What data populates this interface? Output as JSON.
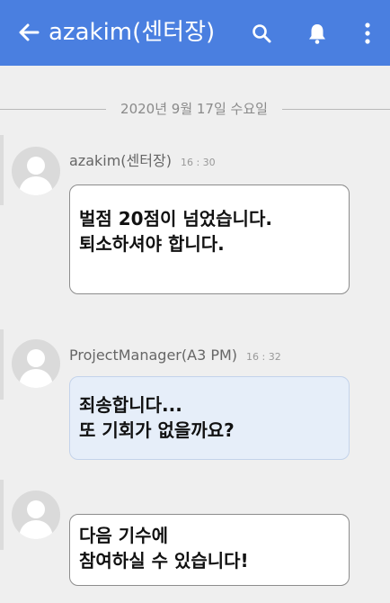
{
  "header": {
    "title": "azakim(센터장)",
    "bg_color": "#4a7fe0",
    "icons": [
      "back-arrow-icon",
      "search-icon",
      "bell-icon",
      "more-vertical-icon"
    ]
  },
  "date_divider": "2020년 9월 17일 수요일",
  "messages": [
    {
      "sender": "azakim(센터장)",
      "time": "16 : 30",
      "lines": [
        "벌점 20점이 넘었습니다.",
        "퇴소하셔야 합니다."
      ],
      "bubble_color": "#ffffff"
    },
    {
      "sender": "ProjectManager(A3 PM)",
      "time": "16 : 32",
      "lines": [
        "죄송합니다...",
        "또 기회가 없을까요?"
      ],
      "bubble_color": "#e6eef9"
    },
    {
      "sender": "",
      "time": "",
      "lines": [
        "다음 기수에",
        "참여하실 수 있습니다!"
      ],
      "bubble_color": "#ffffff"
    }
  ]
}
